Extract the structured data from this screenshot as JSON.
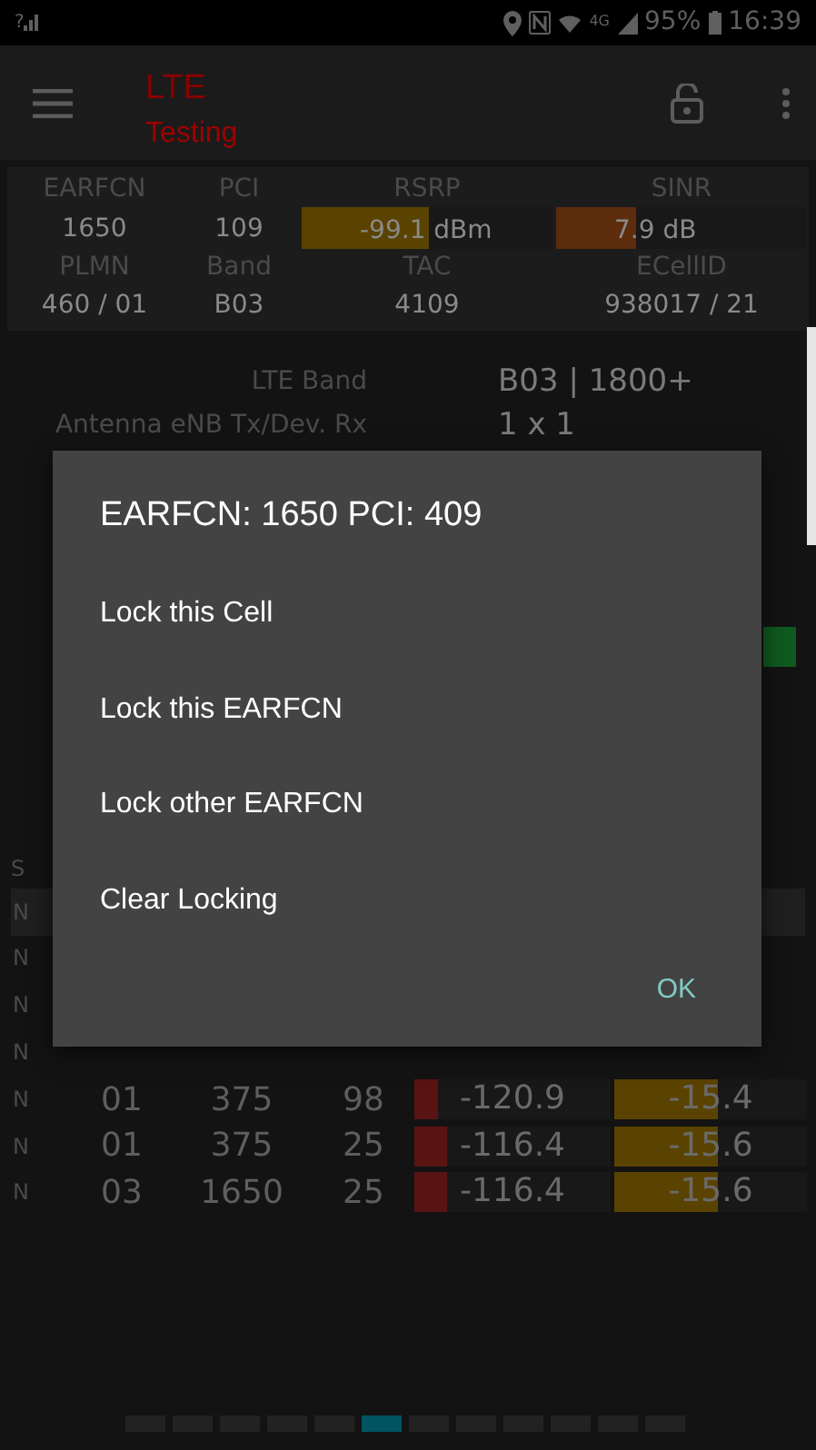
{
  "status_bar": {
    "signal_mark": "?",
    "network": "4G",
    "battery": "95%",
    "time": "16:39"
  },
  "app_bar": {
    "title": "LTE",
    "subtitle": "Testing"
  },
  "serving_cell": {
    "rows": [
      {
        "cells": [
          {
            "kind": "label",
            "text": "EARFCN"
          },
          {
            "kind": "label",
            "text": "PCI"
          },
          {
            "kind": "label",
            "text": "RSRP"
          },
          {
            "kind": "label",
            "text": "SINR"
          }
        ]
      },
      {
        "cells": [
          {
            "kind": "value",
            "text": "1650"
          },
          {
            "kind": "value",
            "text": "109"
          },
          {
            "kind": "meter",
            "text": "-99.1 dBm",
            "level": 0.51,
            "color": "#5a4300"
          },
          {
            "kind": "meter",
            "text": "7.9 dB",
            "level": 0.32,
            "color": "#5c2c0c"
          }
        ]
      },
      {
        "cells": [
          {
            "kind": "label",
            "text": "PLMN"
          },
          {
            "kind": "label",
            "text": "Band"
          },
          {
            "kind": "label",
            "text": "TAC"
          },
          {
            "kind": "label",
            "text": "ECellID"
          }
        ]
      },
      {
        "cells": [
          {
            "kind": "value",
            "text": "460 / 01"
          },
          {
            "kind": "value",
            "text": "B03"
          },
          {
            "kind": "value",
            "text": "4109"
          },
          {
            "kind": "value",
            "text": "938017 / 21"
          }
        ]
      }
    ]
  },
  "details": [
    {
      "label": "LTE Band",
      "value": "B03 | 1800+"
    },
    {
      "label": "Antenna eNB Tx/Dev. Rx",
      "value": "1 x 1"
    }
  ],
  "neighbors": {
    "header": "S",
    "rows": [
      {
        "type": "N",
        "selected": true
      },
      {
        "type": "N",
        "selected": false
      },
      {
        "type": "N",
        "selected": false
      },
      {
        "type": "N",
        "selected": false
      },
      {
        "type": "N",
        "selected": false,
        "band": "01",
        "earfcn": "375",
        "pci": "98",
        "rsrp": {
          "reading": "-120.9",
          "level": 0.12
        },
        "rsrq": {
          "reading": "-15.4",
          "level": 0.54
        }
      },
      {
        "type": "N",
        "selected": false,
        "band": "01",
        "earfcn": "375",
        "pci": "25",
        "rsrp": {
          "reading": "-116.4",
          "level": 0.17
        },
        "rsrq": {
          "reading": "-15.6",
          "level": 0.54
        }
      },
      {
        "type": "N",
        "selected": false,
        "band": "03",
        "earfcn": "1650",
        "pci": "25",
        "rsrp": {
          "reading": "-116.4",
          "level": 0.17
        },
        "rsrq": {
          "reading": "-15.6",
          "level": 0.54
        }
      }
    ]
  },
  "dialog": {
    "title": "EARFCN: 1650 PCI: 409",
    "options": [
      "Lock this Cell",
      "Lock this EARFCN",
      "Lock other EARFCN",
      "Clear Locking"
    ],
    "button": "OK"
  },
  "pager": [
    {
      "selected": false
    },
    {
      "selected": false
    },
    {
      "selected": false
    },
    {
      "selected": false
    },
    {
      "selected": false
    },
    {
      "selected": true
    },
    {
      "selected": false
    },
    {
      "selected": false
    },
    {
      "selected": false
    },
    {
      "selected": false
    },
    {
      "selected": false
    },
    {
      "selected": false
    }
  ]
}
